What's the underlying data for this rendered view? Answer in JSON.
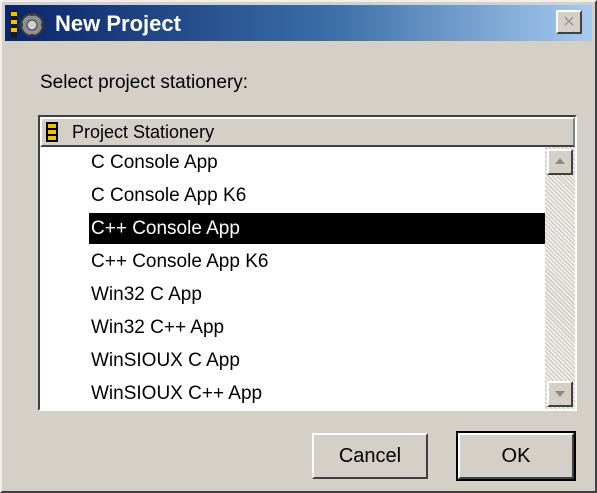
{
  "window": {
    "title": "New Project",
    "close_glyph": "✕"
  },
  "prompt": "Select project stationery:",
  "list": {
    "header": "Project Stationery",
    "items": [
      {
        "label": "C Console App",
        "selected": false
      },
      {
        "label": "C Console App K6",
        "selected": false
      },
      {
        "label": "C++ Console App",
        "selected": true
      },
      {
        "label": "C++ Console App K6",
        "selected": false
      },
      {
        "label": "Win32 C App",
        "selected": false
      },
      {
        "label": "Win32 C++ App",
        "selected": false
      },
      {
        "label": "WinSIOUX C App",
        "selected": false
      },
      {
        "label": "WinSIOUX C++ App",
        "selected": false
      }
    ]
  },
  "buttons": {
    "cancel": "Cancel",
    "ok": "OK"
  },
  "icons": {
    "title": "codewarrior-app-icon",
    "header": "stationery-folder-icon",
    "close": "close-icon"
  },
  "colors": {
    "titlebar_start": "#0a246a",
    "titlebar_end": "#a6caf0",
    "face": "#d4d0c8",
    "selection": "#000000"
  }
}
